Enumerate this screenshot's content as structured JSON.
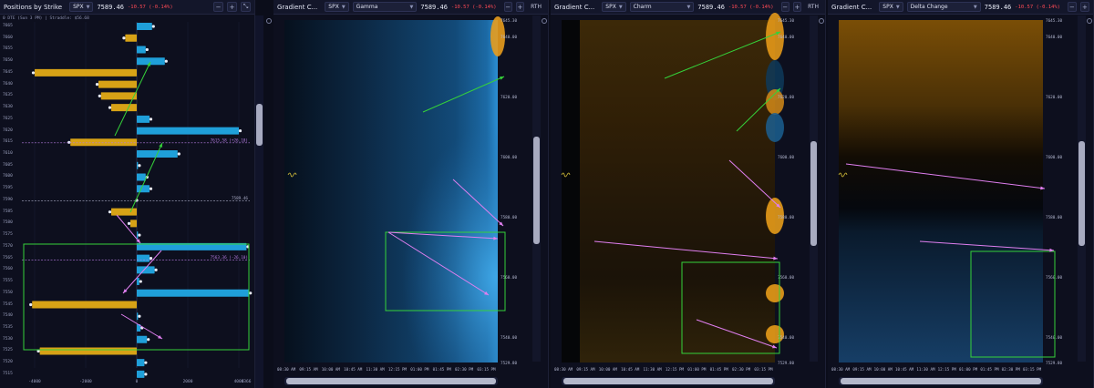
{
  "positions": {
    "title": "Positions by Strike",
    "ticker": "SPX",
    "price": "7589.46",
    "change": "-10.57 (-0.14%)",
    "subtitle": "0 DTE (Sun 3 PM)  |  Straddle: $56.68",
    "strikes": [
      "7665",
      "7660",
      "7655",
      "7650",
      "7645",
      "7640",
      "7635",
      "7630",
      "7625",
      "7620",
      "7615",
      "7610",
      "7605",
      "7600",
      "7595",
      "7590",
      "7585",
      "7580",
      "7575",
      "7570",
      "7565",
      "7560",
      "7555",
      "7550",
      "7545",
      "7540",
      "7535",
      "7530",
      "7525",
      "7520",
      "7515"
    ],
    "x_ticks": [
      "-6000",
      "-4000",
      "-2000",
      "0",
      "2000",
      "4000",
      "6366"
    ],
    "line_labels": {
      "upper": "7615.58 (+26.18)",
      "price": "7589.46",
      "lower": "7563.36 (-26.10)"
    },
    "bars": [
      {
        "strike": "7665",
        "value": 600
      },
      {
        "strike": "7660",
        "value": -450
      },
      {
        "strike": "7655",
        "value": 350
      },
      {
        "strike": "7650",
        "value": 1100
      },
      {
        "strike": "7645",
        "value": -4000
      },
      {
        "strike": "7640",
        "value": -1500
      },
      {
        "strike": "7635",
        "value": -1400
      },
      {
        "strike": "7630",
        "value": -1000
      },
      {
        "strike": "7625",
        "value": 500
      },
      {
        "strike": "7620",
        "value": 4000
      },
      {
        "strike": "7615",
        "value": -2600
      },
      {
        "strike": "7610",
        "value": 1600
      },
      {
        "strike": "7605",
        "value": 50
      },
      {
        "strike": "7600",
        "value": 350
      },
      {
        "strike": "7595",
        "value": 500
      },
      {
        "strike": "7590",
        "value": 0
      },
      {
        "strike": "7585",
        "value": -1000
      },
      {
        "strike": "7580",
        "value": -250
      },
      {
        "strike": "7575",
        "value": 50
      },
      {
        "strike": "7570",
        "value": 4300
      },
      {
        "strike": "7565",
        "value": 500
      },
      {
        "strike": "7560",
        "value": 700
      },
      {
        "strike": "7555",
        "value": 100
      },
      {
        "strike": "7550",
        "value": 4400
      },
      {
        "strike": "7545",
        "value": -4100
      },
      {
        "strike": "7540",
        "value": 50
      },
      {
        "strike": "7535",
        "value": 150
      },
      {
        "strike": "7530",
        "value": 400
      },
      {
        "strike": "7525",
        "value": -3800
      },
      {
        "strike": "7520",
        "value": 300
      },
      {
        "strike": "7515",
        "value": 300
      }
    ]
  },
  "charts": [
    {
      "title": "Gradient C...",
      "ticker": "SPX",
      "metric": "Gamma",
      "price": "7589.46",
      "change": "-10.57 (-0.14%)",
      "rth": "RTH",
      "y_ticks": [
        "7645.30",
        "7640.00",
        "7620.00",
        "7600.00",
        "7580.00",
        "7560.00",
        "7540.00",
        "7529.80"
      ],
      "x_ticks": [
        "08:30 AM",
        "09:15 AM",
        "10:00 AM",
        "10:45 AM",
        "11:30 AM",
        "12:15 PM",
        "01:00 PM",
        "01:45 PM",
        "02:30 PM",
        "03:15 PM"
      ]
    },
    {
      "title": "Gradient C...",
      "ticker": "SPX",
      "metric": "Charm",
      "price": "7589.46",
      "change": "-10.57 (-0.14%)",
      "rth": "RTH",
      "y_ticks": [
        "7645.30",
        "7640.00",
        "7620.00",
        "7600.00",
        "7580.00",
        "7560.00",
        "7540.00",
        "7529.80"
      ],
      "x_ticks": [
        "08:30 AM",
        "09:15 AM",
        "10:00 AM",
        "10:45 AM",
        "11:30 AM",
        "12:15 PM",
        "01:00 PM",
        "01:45 PM",
        "02:30 PM",
        "03:15 PM"
      ]
    },
    {
      "title": "Gradient C...",
      "ticker": "SPX",
      "metric": "Delta Change",
      "price": "7589.46",
      "change": "-10.57 (-0.14%)",
      "rth": "",
      "y_ticks": [
        "7645.30",
        "7640.00",
        "7620.00",
        "7600.00",
        "7580.00",
        "7560.00",
        "7540.00",
        "7529.80"
      ],
      "x_ticks": [
        "08:30 AM",
        "09:15 AM",
        "10:00 AM",
        "10:45 AM",
        "11:30 AM",
        "12:15 PM",
        "01:00 PM",
        "01:45 PM",
        "02:30 PM",
        "03:15 PM"
      ]
    }
  ],
  "colors": {
    "call": "#1f9fd9",
    "put": "#d7a216",
    "annot_green": "#35d23a",
    "annot_pink": "#e07ff0",
    "negative": "#ff4a55"
  },
  "icons": {
    "minus": "minus-icon",
    "plus": "plus-icon",
    "collapse": "collapse-icon",
    "gear": "gear-icon"
  }
}
